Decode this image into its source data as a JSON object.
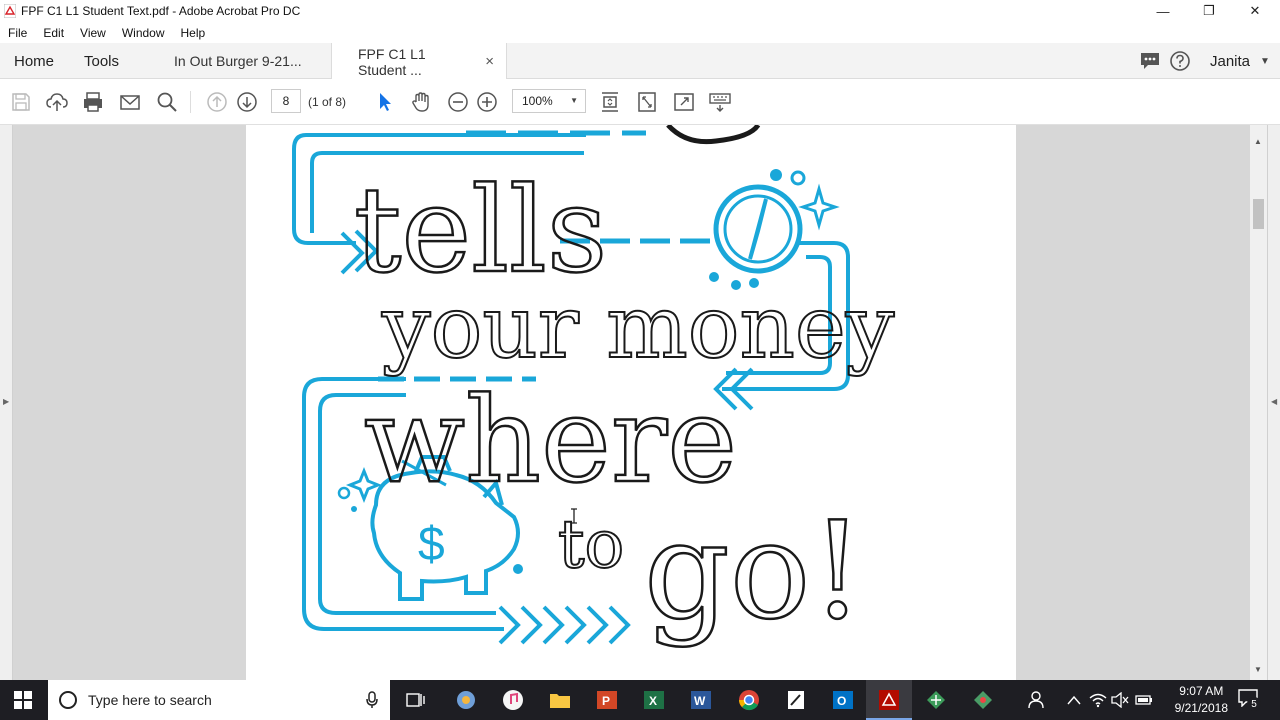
{
  "window": {
    "title": "FPF C1 L1 Student Text.pdf - Adobe Acrobat Pro DC"
  },
  "menu": [
    "File",
    "Edit",
    "View",
    "Window",
    "Help"
  ],
  "nav": {
    "home": "Home",
    "tools": "Tools",
    "user": "Janita"
  },
  "tabs": [
    {
      "label": "In  Out Burger 9-21..."
    },
    {
      "label": "FPF C1 L1 Student ...",
      "close": "×"
    }
  ],
  "toolbar": {
    "page_current": "8",
    "page_count": "(1 of 8)",
    "zoom": "100%"
  },
  "page_content": {
    "line1": "tells",
    "line2": "your money",
    "line3": "where",
    "line4a": "to",
    "line4b": "go!",
    "dollar": "$"
  },
  "taskbar": {
    "search_placeholder": "Type here to search",
    "time": "9:07 AM",
    "date": "9/21/2018",
    "notif_count": "5"
  },
  "colors": {
    "accent_blue": "#1aa7d9",
    "ink": "#1a1a1a"
  }
}
